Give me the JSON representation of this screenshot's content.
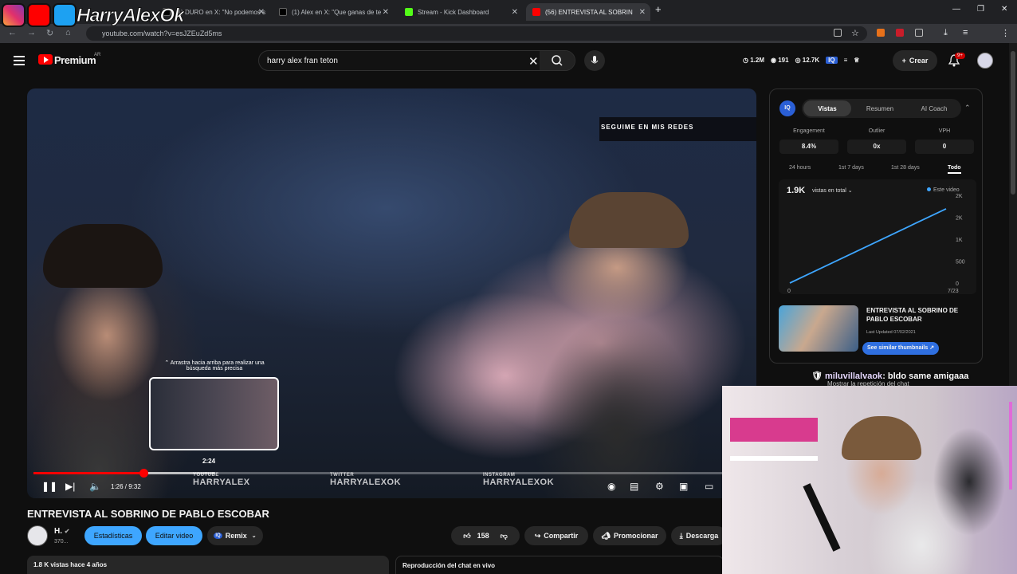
{
  "browser": {
    "tabs": [
      {
        "title": "(1) DURO en X: \"No podemos s",
        "icon": "x-icon"
      },
      {
        "title": "(1) Alex en X: \"Que ganas de te",
        "icon": "x-icon"
      },
      {
        "title": "Stream - Kick Dashboard",
        "icon": "kick-icon"
      },
      {
        "title": "(56) ENTREVISTA AL SOBRIN",
        "icon": "youtube-icon",
        "active": true
      }
    ],
    "url": "youtube.com/watch?v=esJZEuZd5ms"
  },
  "overlay": {
    "streamer_name": "HarryAlexOk"
  },
  "header": {
    "brand": "Premium",
    "region": "AR",
    "search_value": "harry alex fran teton",
    "stats": {
      "views": "1.2M",
      "videos": "191",
      "subs": "12.7K"
    },
    "create_label": "Crear",
    "notifications": "9+"
  },
  "player": {
    "social_banner": "SEGUIME EN MIS REDES",
    "drag_hint": "Arrastra hacia arriba para realizar una búsqueda más precisa",
    "preview_time": "2:24",
    "current_time": "1:26 / 9:32",
    "progress": 0.153,
    "hover_position": 0.253,
    "socials": [
      {
        "platform": "YOUTUBE",
        "handle": "HARRYALEX"
      },
      {
        "platform": "TWITTER",
        "handle": "HARRYALEXOK"
      },
      {
        "platform": "INSTAGRAM",
        "handle": "HARRYALEXOK"
      }
    ]
  },
  "video": {
    "title": "ENTREVISTA AL SOBRINO DE PABLO ESCOBAR",
    "channel": "H.",
    "subscribers": "370...",
    "stats_btn": "Estadísticas",
    "edit_btn": "Editar video",
    "remix_btn": "Remix",
    "likes": "158",
    "share_btn": "Compartir",
    "promote_btn": "Promocionar",
    "download_btn": "Descarga",
    "meta": "1.8 K vistas  hace 4 años",
    "chat_replay": "Reproducción del chat en vivo"
  },
  "panel": {
    "logo": "IQ",
    "tabs": [
      "Vistas",
      "Resumen",
      "AI Coach"
    ],
    "metrics": [
      {
        "label": "Engagement",
        "value": "8.4%"
      },
      {
        "label": "Outlier",
        "value": "0x"
      },
      {
        "label": "VPH",
        "value": "0"
      }
    ],
    "ranges": [
      "24 hours",
      "1st 7 days",
      "1st 28 days",
      "Todo"
    ],
    "active_range": "Todo",
    "chart_total": "1.9K",
    "chart_mode": "vistas en total",
    "chart_legend": "Este video",
    "similar": {
      "title": "ENTREVISTA AL SOBRINO DE PABLO ESCOBAR",
      "updated": "Last Updated 07/02/2021",
      "button": "See similar thumbnails"
    }
  },
  "chart_data": {
    "type": "line",
    "series": [
      {
        "name": "Este video",
        "x": [
          "0",
          "7/23"
        ],
        "y": [
          0,
          1900
        ]
      }
    ],
    "x_tick_labels": [
      "0",
      "7/23"
    ],
    "y_tick_labels": [
      "0",
      "500",
      "1K",
      "2K",
      "2K"
    ],
    "ylim": [
      0,
      2000
    ],
    "color": "#3ea6ff"
  },
  "chat": {
    "user": "miluvillalvaok",
    "message": ": bldo same amigaaa",
    "sub": "Mostrar la repetición del chat"
  },
  "colors": {
    "accent": "#3ea6ff",
    "youtube_red": "#ff0000",
    "panel_blue": "#2f6fe0"
  }
}
